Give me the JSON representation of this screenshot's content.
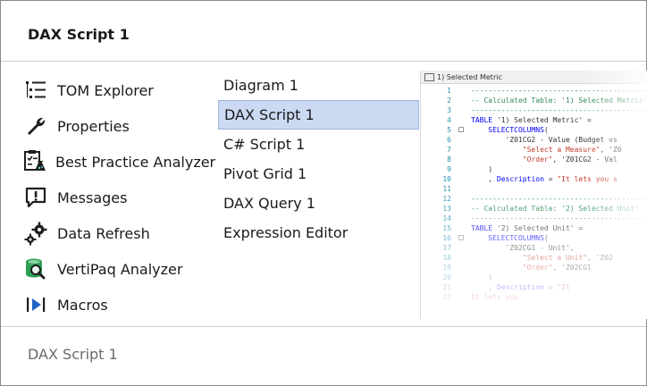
{
  "header": {
    "title": "DAX Script 1"
  },
  "tools": [
    {
      "label": "TOM Explorer",
      "icon": "tree-list-icon"
    },
    {
      "label": "Properties",
      "icon": "wrench-icon"
    },
    {
      "label": "Best Practice Analyzer",
      "icon": "checklist-flask-icon"
    },
    {
      "label": "Messages",
      "icon": "message-alert-icon"
    },
    {
      "label": "Data Refresh",
      "icon": "gears-icon"
    },
    {
      "label": "VertiPaq Analyzer",
      "icon": "database-magnifier-icon"
    },
    {
      "label": "Macros",
      "icon": "play-step-icon"
    }
  ],
  "documents": [
    {
      "label": "Diagram 1",
      "selected": false
    },
    {
      "label": "DAX Script 1",
      "selected": true
    },
    {
      "label": "C# Script 1",
      "selected": false
    },
    {
      "label": "Pivot Grid 1",
      "selected": false
    },
    {
      "label": "DAX Query 1",
      "selected": false
    },
    {
      "label": "Expression Editor",
      "selected": false
    }
  ],
  "preview": {
    "title": "1) Selected Metric",
    "lines": [
      {
        "n": "1",
        "parts": [
          [
            "c-com",
            "-----------------------------------------"
          ]
        ]
      },
      {
        "n": "2",
        "parts": [
          [
            "c-com",
            "-- Calculated Table: '1) Selected Metric'"
          ]
        ]
      },
      {
        "n": "3",
        "parts": [
          [
            "c-com",
            "-----------------------------------------"
          ]
        ]
      },
      {
        "n": "4",
        "parts": [
          [
            "c-kw",
            "TABLE "
          ],
          [
            "tx",
            "'1) Selected Metric' ="
          ]
        ]
      },
      {
        "n": "5",
        "box": true,
        "parts": [
          [
            "c-kw",
            "    SELECTCOLUMNS"
          ],
          [
            "tx",
            "("
          ]
        ]
      },
      {
        "n": "6",
        "parts": [
          [
            "tx",
            "        'Z01CG2 - Value (Budget vs"
          ]
        ]
      },
      {
        "n": "7",
        "parts": [
          [
            "c-str",
            "            \"Select a Measure\""
          ],
          [
            "tx",
            ", 'Z0"
          ]
        ]
      },
      {
        "n": "8",
        "parts": [
          [
            "c-str",
            "            \"Order\""
          ],
          [
            "tx",
            ", 'Z01CG2 - Val"
          ]
        ]
      },
      {
        "n": "9",
        "parts": [
          [
            "tx",
            "    )"
          ]
        ]
      },
      {
        "n": "10",
        "parts": [
          [
            "tx",
            "    , "
          ],
          [
            "c-kw",
            "Description"
          ],
          [
            "tx",
            " = "
          ],
          [
            "c-str",
            "\"It lets you s"
          ]
        ]
      },
      {
        "n": "11",
        "parts": []
      },
      {
        "n": "12",
        "parts": [
          [
            "c-com",
            "-----------------------------------------"
          ]
        ]
      },
      {
        "n": "13",
        "parts": [
          [
            "c-com",
            "-- Calculated Table: '2) Selected Unit'"
          ]
        ]
      },
      {
        "n": "14",
        "parts": [
          [
            "c-com",
            "-----------------------------------------"
          ]
        ]
      },
      {
        "n": "15",
        "parts": [
          [
            "c-kw",
            "TABLE "
          ],
          [
            "tx",
            "'2) Selected Unit' ="
          ]
        ]
      },
      {
        "n": "16",
        "box": true,
        "parts": [
          [
            "c-kw",
            "    SELECTCOLUMNS"
          ],
          [
            "tx",
            "("
          ]
        ]
      },
      {
        "n": "17",
        "parts": [
          [
            "tx",
            "        'Z02CG1 - Unit',"
          ]
        ]
      },
      {
        "n": "18",
        "parts": [
          [
            "c-str",
            "            \"Select a Unit\""
          ],
          [
            "tx",
            ", 'Z02"
          ]
        ]
      },
      {
        "n": "19",
        "parts": [
          [
            "c-str",
            "            \"Order\""
          ],
          [
            "tx",
            ", 'Z02CG1"
          ]
        ]
      },
      {
        "n": "20",
        "parts": [
          [
            "tx",
            "    )"
          ]
        ]
      },
      {
        "n": "21",
        "parts": [
          [
            "tx",
            "    , "
          ],
          [
            "c-kw",
            "Description"
          ],
          [
            "tx",
            " = "
          ],
          [
            "c-str",
            "\"It"
          ]
        ]
      },
      {
        "n": "22",
        "parts": [
          [
            "c-str",
            "It lets you"
          ]
        ]
      }
    ]
  },
  "footer": {
    "text": "DAX Script 1"
  }
}
